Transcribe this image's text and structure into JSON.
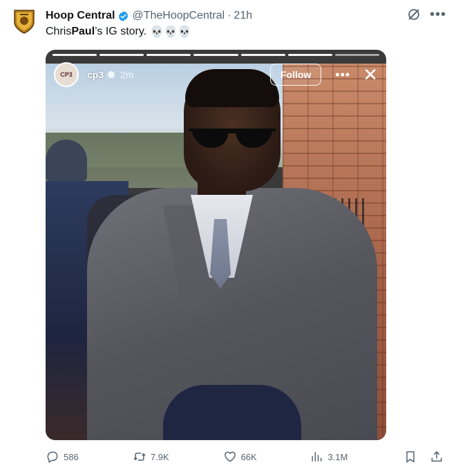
{
  "author": {
    "name": "Hoop Central",
    "handle": "@TheHoopCentral",
    "separator": "·",
    "time": "21h"
  },
  "tweet": {
    "text_start": "Chris ",
    "text_bold": "Paul",
    "text_end": "’s IG story.",
    "emojis": "💀💀💀"
  },
  "story": {
    "username": "cp3",
    "time": "2m",
    "follow_label": "Follow",
    "avatar_text": "CP3",
    "progress_segments": 7,
    "active_segments": 6
  },
  "actions": {
    "replies": "586",
    "retweets": "7.9K",
    "likes": "66K",
    "views": "3.1M"
  },
  "icons": {
    "more": "more-icon",
    "grok": "grok-icon",
    "reply": "reply-icon",
    "retweet": "retweet-icon",
    "like": "heart-icon",
    "views": "views-icon",
    "bookmark": "bookmark-icon",
    "share": "share-icon"
  },
  "colors": {
    "verified": "#1d9bf0",
    "muted_text": "#536471"
  }
}
